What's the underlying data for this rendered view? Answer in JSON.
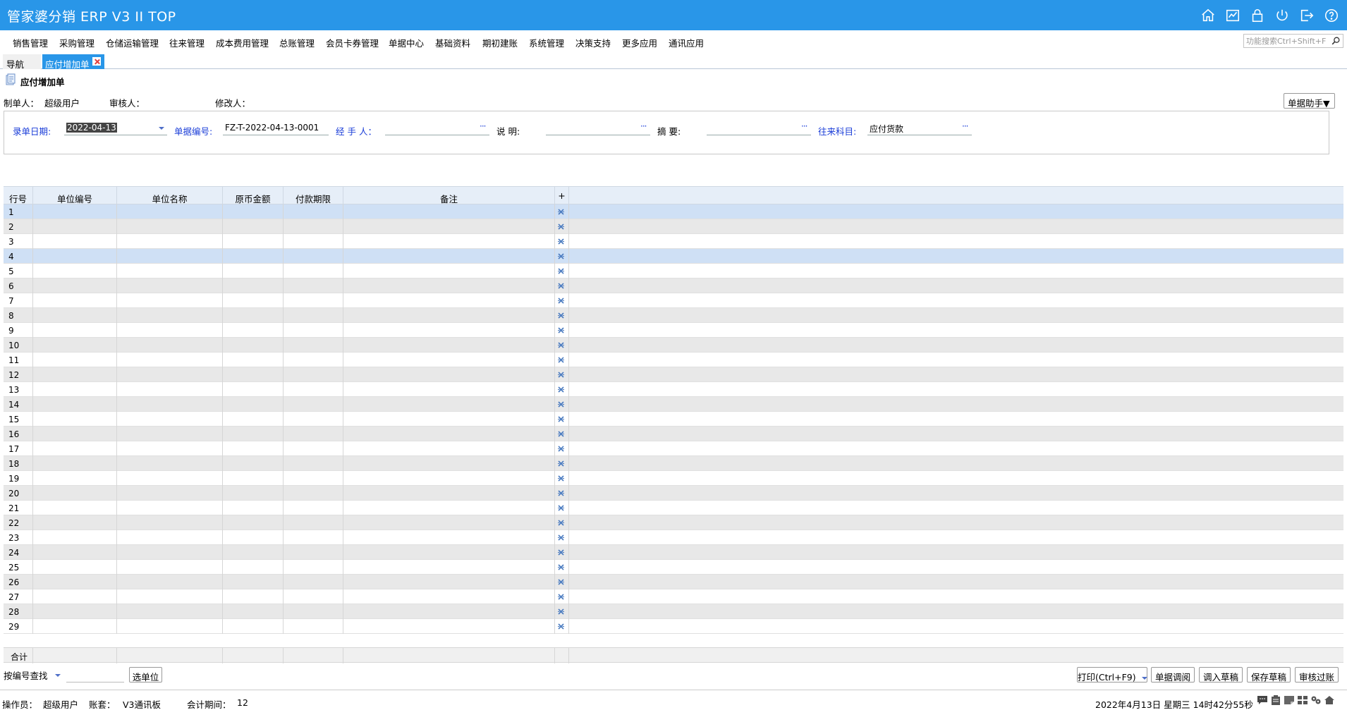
{
  "app": {
    "title": "管家婆分销 ERP V3 II TOP"
  },
  "title_icons": [
    "home-icon",
    "chart-icon",
    "lock-icon",
    "power-icon",
    "exit-icon",
    "help-icon"
  ],
  "menu": {
    "items": [
      "销售管理",
      "采购管理",
      "仓储运输管理",
      "往来管理",
      "成本费用管理",
      "总账管理",
      "会员卡券管理",
      "单据中心",
      "基础资料",
      "期初建账",
      "系统管理",
      "决策支持",
      "更多应用",
      "通讯应用"
    ],
    "search_placeholder": "功能搜索Ctrl+Shift+F"
  },
  "tabs": {
    "nav": "导航",
    "active": "应付增加单"
  },
  "document": {
    "title": "应付增加单",
    "creator_label": "制单人：",
    "creator_value": "超级用户",
    "reviewer_label": "审核人：",
    "modifier_label": "修改人：",
    "helper_button": "单据助手▼"
  },
  "form": {
    "date_label": "录单日期:",
    "date_value": "2022-04-13",
    "number_label": "单据编号:",
    "number_value": "FZ-T-2022-04-13-0001",
    "handler_label": "经 手 人：",
    "handler_value": "",
    "desc_label": "说      明:",
    "desc_value": "",
    "summary_label": "摘      要:",
    "summary_value": "",
    "account_label": "往来科目:",
    "account_value": "应付货款",
    "dots": "···"
  },
  "grid": {
    "columns": [
      "行号",
      "单位编号",
      "单位名称",
      "原币金额",
      "付款期限",
      "备注",
      "+"
    ],
    "rows": [
      "1",
      "2",
      "3",
      "4",
      "5",
      "6",
      "7",
      "8",
      "9",
      "10",
      "11",
      "12",
      "13",
      "14",
      "15",
      "16",
      "17",
      "18",
      "19",
      "20",
      "21",
      "22",
      "23",
      "24",
      "25",
      "26",
      "27",
      "28",
      "29"
    ],
    "selected_rows": [
      1,
      4
    ],
    "footer_label": "合计"
  },
  "toolbar": {
    "find_by": "按编号查找",
    "select_unit": "选单位",
    "print": "打印(Ctrl+F9)",
    "review": "单据调阅",
    "load_draft": "调入草稿",
    "save_draft": "保存草稿",
    "approve": "审核过账"
  },
  "status": {
    "operator_label": "操作员：",
    "operator_value": "超级用户",
    "account_set_label": "账套：",
    "account_set_value": "V3通讯板",
    "period_label": "会计期间：",
    "period_value": "12",
    "datetime": "2022年4月13日  星期三  14时42分55秒"
  }
}
